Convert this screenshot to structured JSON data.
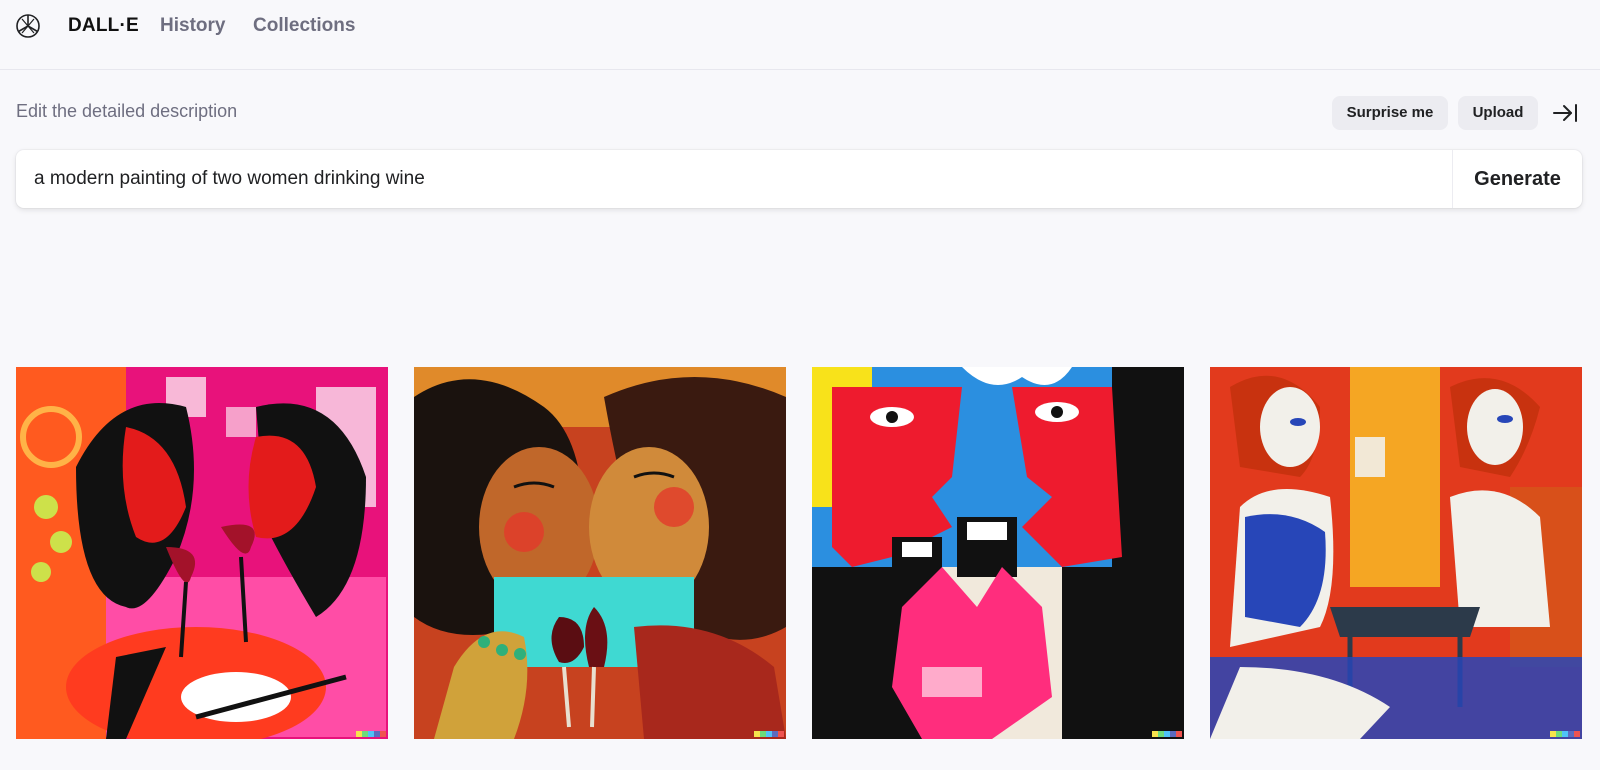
{
  "nav": {
    "brand": "DALL·E",
    "links": [
      "History",
      "Collections"
    ],
    "logo_icon": "openai-logo-icon"
  },
  "prompt": {
    "label": "Edit the detailed description",
    "value": "a modern painting of two women drinking wine",
    "surprise_label": "Surprise me",
    "upload_label": "Upload",
    "generate_label": "Generate",
    "collapse_icon": "arrow-to-right-bar-icon"
  },
  "images": [
    {
      "name": "painting-1",
      "palette": [
        "#e8127b",
        "#ff5a1f",
        "#d01b1b",
        "#111111"
      ]
    },
    {
      "name": "painting-2",
      "palette": [
        "#c0672a",
        "#3fd9d2",
        "#b82222",
        "#231915"
      ]
    },
    {
      "name": "painting-3",
      "palette": [
        "#ee1b2e",
        "#2b8fe0",
        "#ff2d7d",
        "#111111"
      ]
    },
    {
      "name": "painting-4",
      "palette": [
        "#e23a1d",
        "#2746b8",
        "#f5a623",
        "#f2f0ea"
      ]
    }
  ],
  "signature_colors": [
    "#f6e34c",
    "#6ddc7a",
    "#4fc3f7",
    "#5c6bc0",
    "#ef5350"
  ],
  "colors": {
    "background": "#f8f8fb",
    "button_bg": "#ececf1",
    "muted_text": "#6e6e80"
  }
}
